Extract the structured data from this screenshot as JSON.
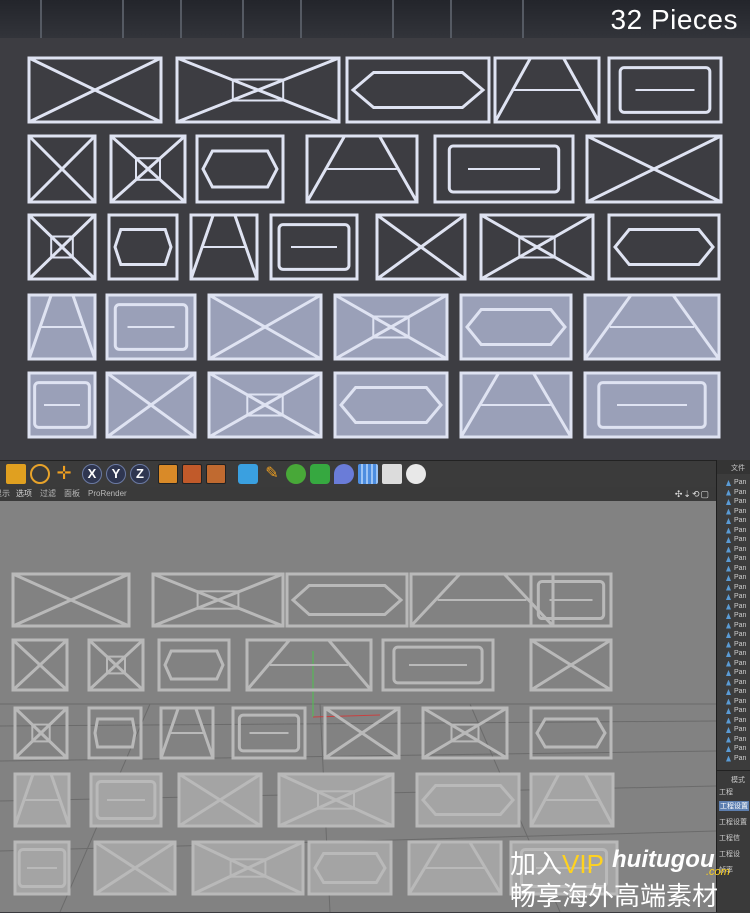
{
  "render": {
    "title": "32 Pieces",
    "panel_color": "#9aa0b8",
    "panel_edge": "#dfe3f2",
    "background": "#3d3d42"
  },
  "toolbar": {
    "buttons": [
      "view-icon",
      "rotate-icon",
      "move-icon",
      "x-axis",
      "y-axis",
      "z-axis",
      "render-region-icon",
      "render-view-icon",
      "render-settings-icon",
      "cube-icon",
      "pen-icon",
      "subdivision-icon",
      "cloner-icon",
      "deformer-icon",
      "floor-icon",
      "camera-icon",
      "light-icon"
    ],
    "axis_x": "X",
    "axis_y": "Y",
    "axis_z": "Z"
  },
  "viewport_menu": {
    "items": [
      "显示",
      "选项",
      "过滤",
      "面板",
      "ProRender"
    ],
    "nav": "✣⇣⟲▢"
  },
  "object_panel": {
    "header": "文件",
    "item_prefix": "Pan",
    "row_count": 30,
    "mode_label": "模式",
    "rows": [
      "工程",
      "工程设置",
      "工程设置",
      "工程信",
      "工程设"
    ],
    "bottom": "帧率"
  },
  "watermark": {
    "line1_prefix": "加入",
    "line1_vip": "VIP",
    "logo": "huitugou",
    "logo_domain": ".com",
    "line2": "畅享海外高端素材"
  }
}
